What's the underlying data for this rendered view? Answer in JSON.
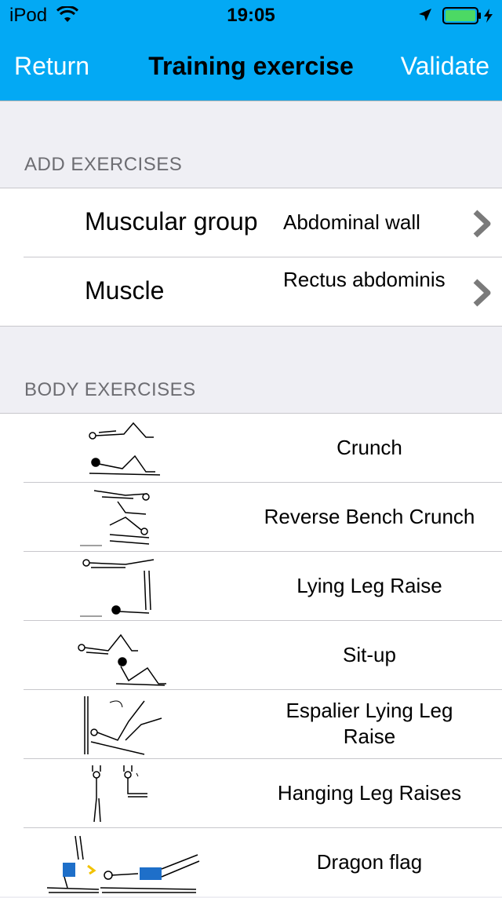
{
  "status_bar": {
    "carrier": "iPod",
    "time": "19:05",
    "icons": [
      "wifi-icon",
      "location-arrow-icon",
      "battery-charging-icon"
    ]
  },
  "nav": {
    "back_label": "Return",
    "title": "Training exercise",
    "action_label": "Validate"
  },
  "colors": {
    "nav_background": "#03a9f4",
    "nav_button_text": "#ffffff",
    "group_background": "#efeff4"
  },
  "add_exercises": {
    "header": "ADD EXERCISES",
    "rows": [
      {
        "label": "Muscular group",
        "value": "Abdominal wall"
      },
      {
        "label": "Muscle",
        "value": "Rectus abdominis"
      }
    ]
  },
  "body_exercises": {
    "header": "BODY EXERCISES",
    "items": [
      {
        "name": "Crunch"
      },
      {
        "name": "Reverse Bench Crunch"
      },
      {
        "name": "Lying Leg Raise"
      },
      {
        "name": "Sit-up"
      },
      {
        "name": "Espalier Lying Leg Raise"
      },
      {
        "name": "Hanging Leg Raises"
      },
      {
        "name": "Dragon flag"
      }
    ]
  }
}
